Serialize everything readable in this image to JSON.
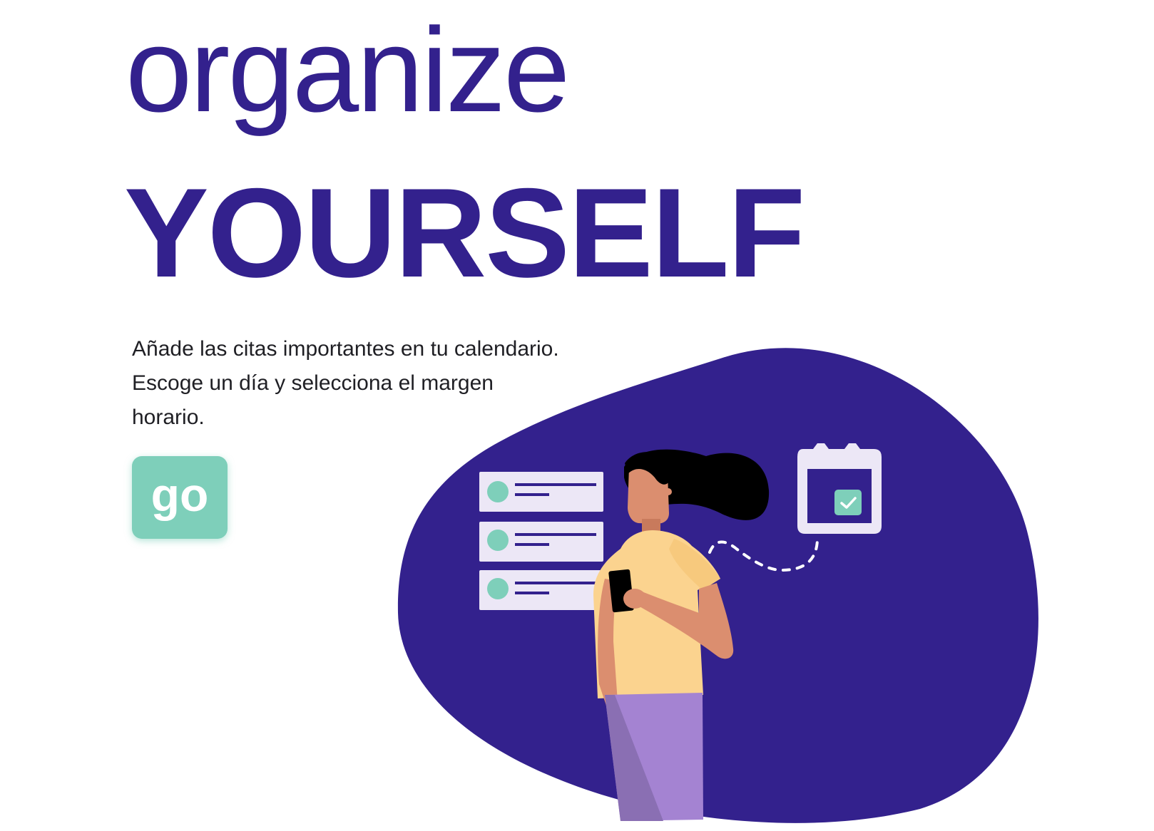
{
  "hero": {
    "title_line1": "organize",
    "title_line2": "YOURSELF",
    "description": "Añade las citas importantes en tu calendario. Escoge un día y selecciona el margen horario.",
    "go_label": "go"
  },
  "illustration": {
    "icons": [
      "blob-background",
      "list-card-icon",
      "calendar-check-icon",
      "woman-with-phone"
    ]
  },
  "colors": {
    "primary": "#33218d",
    "accent": "#7ecfba",
    "text": "#1f1f24",
    "card": "#ece7f6",
    "shirt": "#fbd38f",
    "skin": "#db8e6f",
    "pants": "#a483d2",
    "hair": "#000000"
  }
}
